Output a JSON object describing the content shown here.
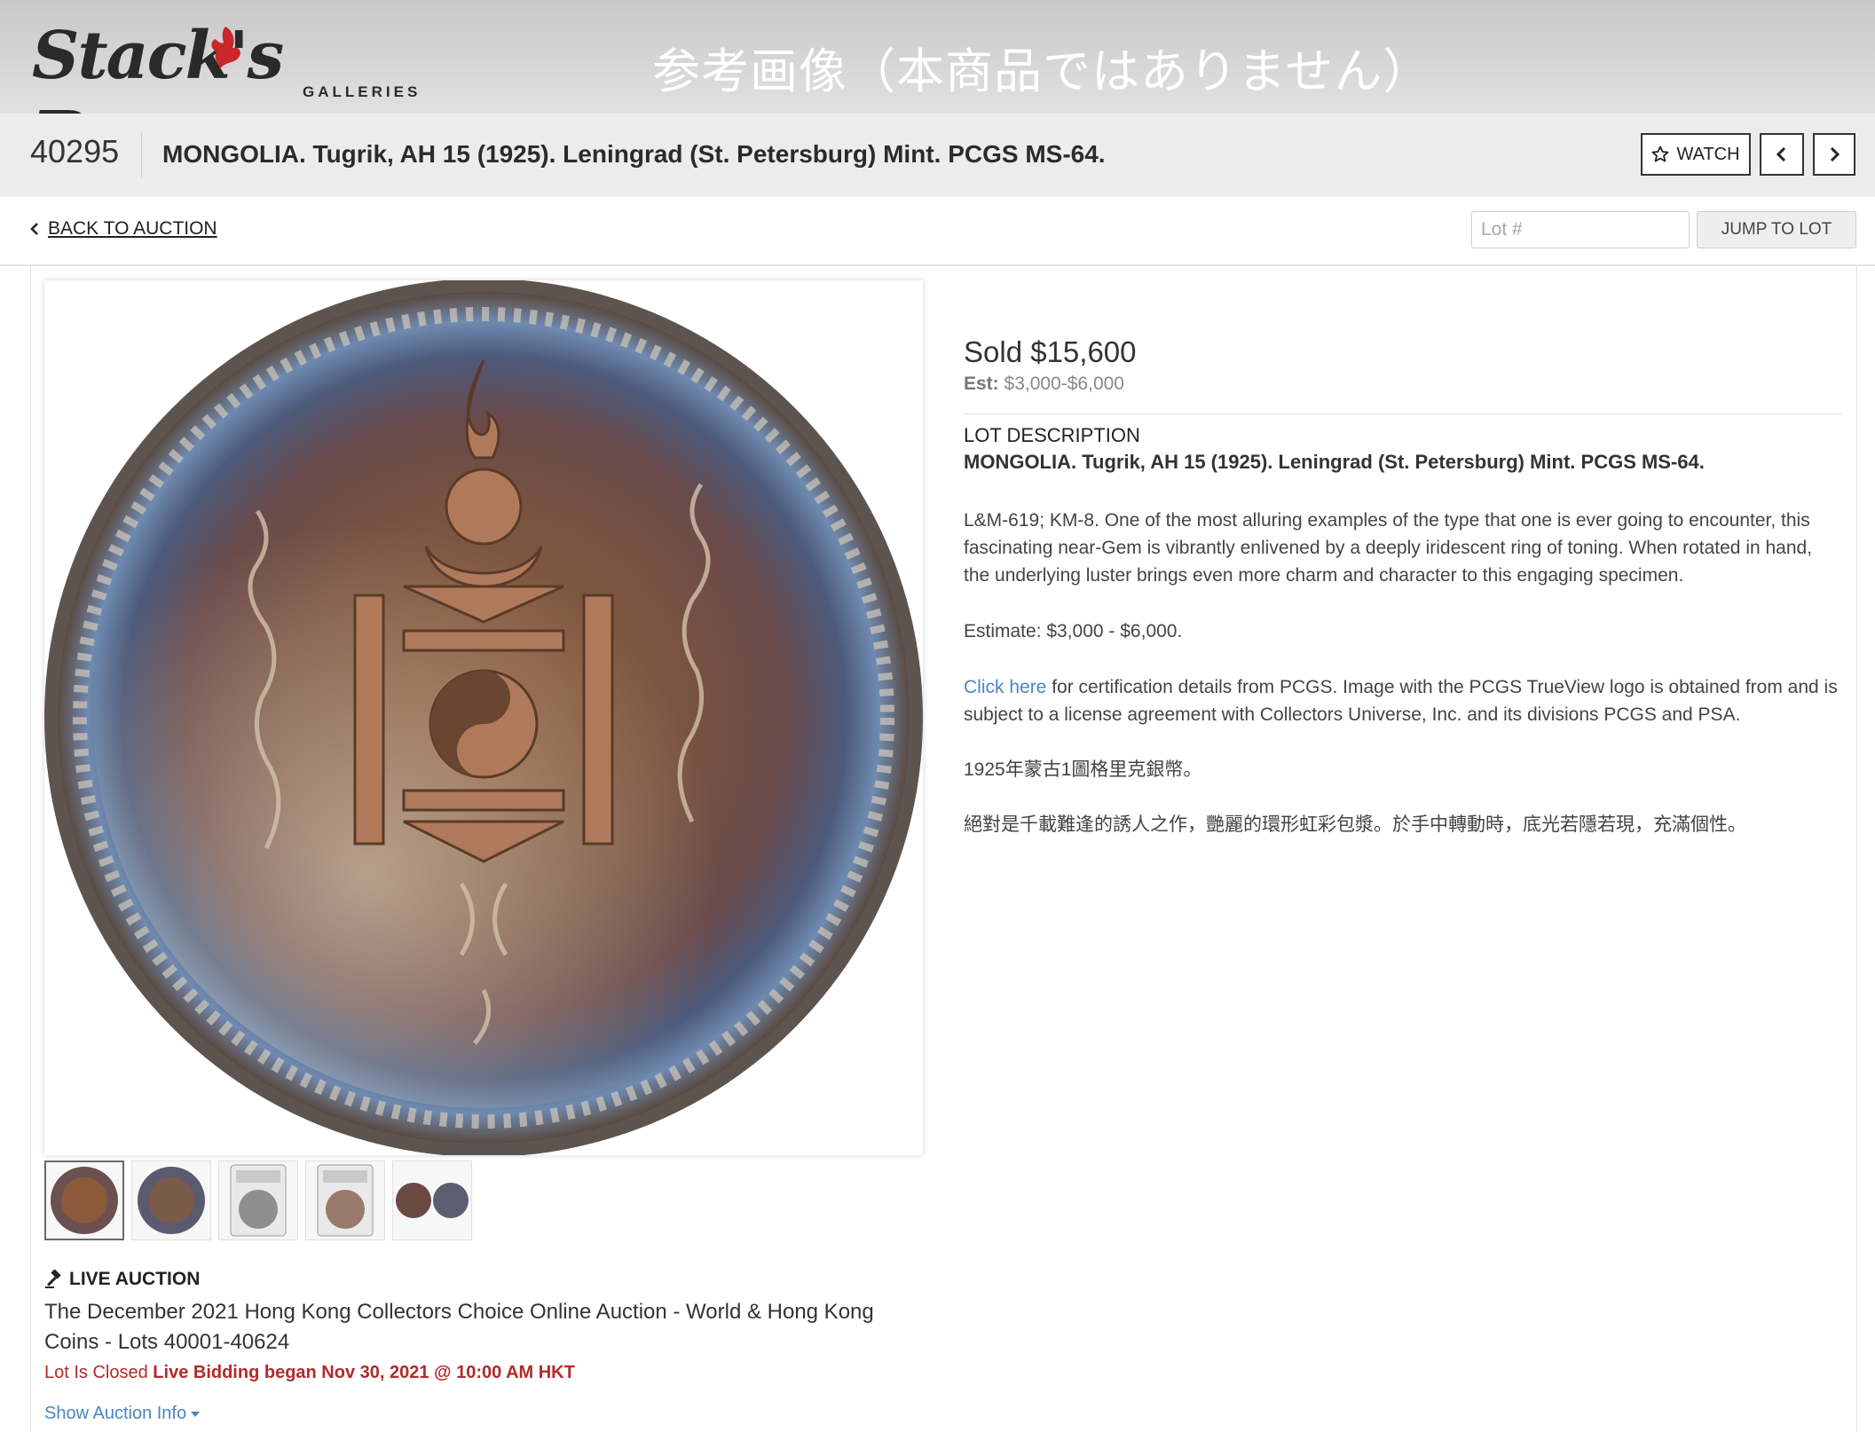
{
  "header": {
    "logo_text": "Stack's Bowers",
    "logo_sub": "GALLERIES",
    "reference_note": "参考画像（本商品ではありません）"
  },
  "lot": {
    "number": "40295",
    "title": "MONGOLIA. Tugrik, AH 15 (1925). Leningrad (St. Petersburg) Mint. PCGS MS-64.",
    "watch_label": "WATCH"
  },
  "nav": {
    "back_label": "BACK TO AUCTION",
    "lot_placeholder": "Lot #",
    "jump_label": "JUMP TO LOT"
  },
  "pricing": {
    "sold": "Sold $15,600",
    "est_label": "Est:",
    "est_value": "$3,000-$6,000"
  },
  "description": {
    "heading": "LOT DESCRIPTION",
    "title": "MONGOLIA. Tugrik, AH 15 (1925). Leningrad (St. Petersburg) Mint. PCGS MS-64.",
    "p1": "L&M-619; KM-8. One of the most alluring examples of the type that one is ever going to encounter, this fascinating near-Gem is vibrantly enlivened by a deeply iridescent ring of toning. When rotated in hand, the underlying luster brings even more charm and character to this engaging specimen.",
    "estimate": "Estimate: $3,000 - $6,000.",
    "click_here": "Click here",
    "cert_text": " for certification details from PCGS. Image with the PCGS TrueView logo is obtained from and is subject to a license agreement with Collectors Universe, Inc. and its divisions PCGS and PSA.",
    "zh1": "1925年蒙古1圖格里克銀幣。",
    "zh2": "絕對是千載難逢的誘人之作，艷麗的環形虹彩包漿。於手中轉動時，底光若隱若現，充滿個性。"
  },
  "auction": {
    "live_label": "LIVE AUCTION",
    "name": "The December 2021 Hong Kong Collectors Choice Online Auction - World & Hong Kong Coins - Lots 40001-40624",
    "closed": "Lot Is Closed",
    "bidding": "Live Bidding began Nov 30, 2021 @ 10:00 AM HKT",
    "show_info": "Show Auction Info"
  },
  "thumbnails": [
    "coin-obverse",
    "coin-reverse",
    "slab-front",
    "slab-back",
    "trueview-pair"
  ],
  "colors": {
    "link": "#4a86bf",
    "closed": "#b22a2a",
    "header_bg": "#d6d6d6"
  }
}
